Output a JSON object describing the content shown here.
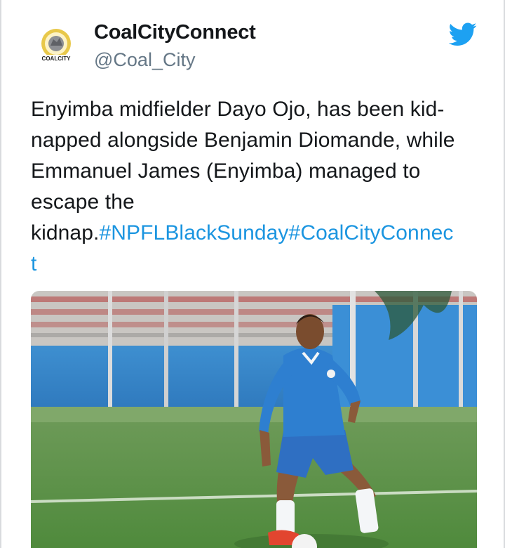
{
  "account": {
    "display_name": "CoalCityConnect",
    "handle": "@Coal_City",
    "avatar_icon": "coalcity-logo-avatar",
    "avatar_logo_text": "COALCITY"
  },
  "brand": {
    "icon": "twitter-bird-icon",
    "color": "#1da1f2"
  },
  "tweet": {
    "lines": [
      "Enyimba midfielder Dayo Ojo, has been kid-",
      "napped alongside Benjamin Diomande, while",
      "Emmanuel James (Enyimba) managed to",
      "escape the"
    ],
    "last_line_prefix": "kidnap.",
    "hashtags": [
      "#NPFLBlackSunday",
      "#CoalCityConnec",
      "t"
    ],
    "link_color": "#1b95e0"
  },
  "media": {
    "type": "photo",
    "subject": "footballer-in-blue-kit"
  }
}
